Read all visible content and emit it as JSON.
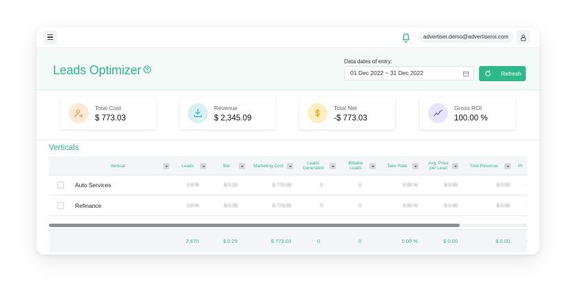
{
  "topbar": {
    "email": "advertiser.demo@advertiseroi.com"
  },
  "header": {
    "title": "Leads Optimizer",
    "date_label": "Data dates of entry:",
    "date_value": "01 Dec 2022 ~ 31 Dec 2022",
    "refresh_label": "Refresh"
  },
  "kpis": [
    {
      "label": "Total Cost",
      "value": "$ 773.03",
      "color": "#fde9d5",
      "icon": "user-arrow-icon"
    },
    {
      "label": "Revenue",
      "value": "$ 2,345.09",
      "color": "#d8f0f3",
      "icon": "download-icon"
    },
    {
      "label": "Total Net",
      "value": "-$ 773.03",
      "color": "#fdeec4",
      "icon": "dollar-icon"
    },
    {
      "label": "Gross ROI",
      "value": "100.00 %",
      "color": "#e7e4fb",
      "icon": "trend-icon"
    }
  ],
  "verticals": {
    "title": "Verticals",
    "columns": [
      "Vertical",
      "Leads",
      "Bid",
      "Marketing Cost",
      "Leads Generated",
      "Billable Leads",
      "Take Rate",
      "Avg. Price per Lead",
      "Total Revenue",
      "Pr"
    ],
    "rows": [
      {
        "name": "Auto Services",
        "cells": [
          "2,676",
          "$ 0.29",
          "$ 773.03",
          "0",
          "0",
          "0.00 %",
          "$ 0.00",
          "$ 0.00",
          "-"
        ]
      },
      {
        "name": "Refinance",
        "cells": [
          "2,676",
          "$ 0.29",
          "$ 773.03",
          "0",
          "0",
          "0.00 %",
          "$ 0.00",
          "$ 0.00",
          "-"
        ]
      }
    ],
    "totals": [
      "2,676",
      "$ 0.29",
      "$ 773.03",
      "0",
      "0",
      "0.00 %",
      "$ 0.00",
      "$ 0.00",
      "-"
    ]
  }
}
